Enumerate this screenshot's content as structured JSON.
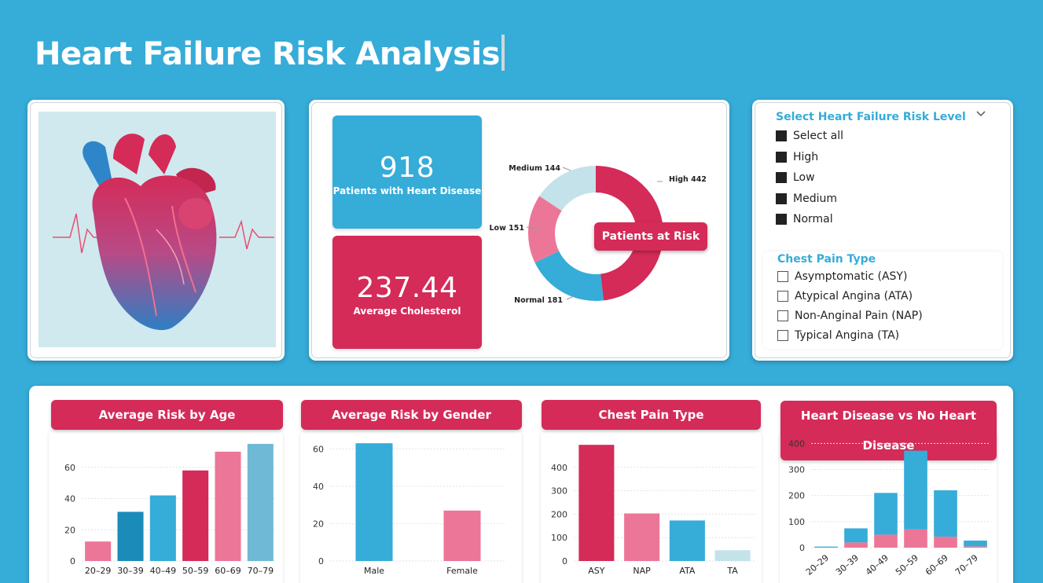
{
  "header": {
    "title": "Heart Failure Risk Analysis"
  },
  "kpis": {
    "patients_value": "918",
    "patients_label": "Patients with Heart Disease",
    "cholesterol_value": "237.44",
    "cholesterol_label": "Average Cholesterol"
  },
  "donut": {
    "center_label": "Patients at Risk",
    "segments": [
      {
        "name": "High",
        "label": "High 442",
        "value": 442,
        "color": "#d42b58"
      },
      {
        "name": "Normal",
        "label": "Normal 181",
        "value": 181,
        "color": "#36acd8"
      },
      {
        "name": "Low",
        "label": "Low 151",
        "value": 151,
        "color": "#ec7697"
      },
      {
        "name": "Medium",
        "label": "Medium 144",
        "value": 144,
        "color": "#c3e2ea"
      }
    ]
  },
  "risk_slicer": {
    "title": "Select Heart Failure Risk Level",
    "options": [
      "Select all",
      "High",
      "Low",
      "Medium",
      "Normal"
    ]
  },
  "chest_slicer": {
    "title": "Chest Pain Type",
    "options": [
      "Asymptomatic (ASY)",
      "Atypical Angina (ATA)",
      "Non-Anginal Pain (NAP)",
      "Typical Angina (TA)"
    ]
  },
  "charts": {
    "age_title": "Average Risk by Age",
    "gender_title": "Average Risk by Gender",
    "chest_title": "Chest Pain Type",
    "disease_title": "Heart Disease vs No Heart Disease"
  },
  "chart_data": [
    {
      "type": "bar",
      "title": "Average Risk by Age",
      "categories": [
        "20–29",
        "30–39",
        "40–49",
        "50–59",
        "60–69",
        "70–79"
      ],
      "values": [
        12.5,
        31.5,
        42,
        58,
        70,
        75
      ],
      "colors": [
        "#ec7697",
        "#1b8cba",
        "#36acd8",
        "#d42b58",
        "#ec7697",
        "#6fb9d6"
      ],
      "yticks": [
        0,
        20,
        40,
        60
      ],
      "ylim": [
        0,
        78
      ]
    },
    {
      "type": "bar",
      "title": "Average Risk by Gender",
      "categories": [
        "Male",
        "Female"
      ],
      "values": [
        63,
        27
      ],
      "colors": [
        "#36acd8",
        "#ec7697"
      ],
      "yticks": [
        0,
        20,
        40,
        60
      ],
      "ylim": [
        0,
        66
      ]
    },
    {
      "type": "bar",
      "title": "Chest Pain Type",
      "categories": [
        "ASY",
        "NAP",
        "ATA",
        "TA"
      ],
      "values": [
        496,
        203,
        173,
        46
      ],
      "colors": [
        "#d42b58",
        "#ec7697",
        "#36acd8",
        "#c3e2ea"
      ],
      "yticks": [
        0,
        100,
        200,
        300,
        400
      ],
      "ylim": [
        0,
        520
      ]
    },
    {
      "type": "bar",
      "title": "Heart Disease vs No Heart Disease",
      "categories": [
        "20–29",
        "30–39",
        "40–49",
        "50–59",
        "60–69",
        "70–79"
      ],
      "series": [
        {
          "values": [
            0,
            20,
            50,
            70,
            42,
            5
          ],
          "color": "#ec7697"
        },
        {
          "values": [
            4,
            54,
            160,
            302,
            178,
            22
          ],
          "color": "#36acd8"
        }
      ],
      "yticks": [
        0,
        100,
        200,
        300,
        400
      ],
      "ylim": [
        0,
        410
      ]
    }
  ]
}
